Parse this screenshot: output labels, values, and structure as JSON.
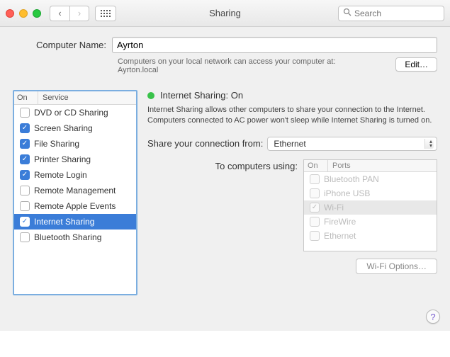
{
  "window": {
    "title": "Sharing"
  },
  "search": {
    "placeholder": "Search"
  },
  "computer_name": {
    "label": "Computer Name:",
    "value": "Ayrton",
    "sub1": "Computers on your local network can access your computer at:",
    "sub2": "Ayrton.local",
    "edit_label": "Edit…"
  },
  "services": {
    "head_on": "On",
    "head_service": "Service",
    "items": [
      {
        "label": "DVD or CD Sharing",
        "on": false,
        "selected": false
      },
      {
        "label": "Screen Sharing",
        "on": true,
        "selected": false
      },
      {
        "label": "File Sharing",
        "on": true,
        "selected": false
      },
      {
        "label": "Printer Sharing",
        "on": true,
        "selected": false
      },
      {
        "label": "Remote Login",
        "on": true,
        "selected": false
      },
      {
        "label": "Remote Management",
        "on": false,
        "selected": false
      },
      {
        "label": "Remote Apple Events",
        "on": false,
        "selected": false
      },
      {
        "label": "Internet Sharing",
        "on": true,
        "selected": true
      },
      {
        "label": "Bluetooth Sharing",
        "on": false,
        "selected": false
      }
    ]
  },
  "detail": {
    "status_title": "Internet Sharing: On",
    "status_color": "#39c24a",
    "desc": "Internet Sharing allows other computers to share your connection to the Internet. Computers connected to AC power won't sleep while Internet Sharing is turned on.",
    "share_from_label": "Share your connection from:",
    "share_from_value": "Ethernet",
    "to_label": "To computers using:",
    "ports": {
      "head_on": "On",
      "head_ports": "Ports",
      "items": [
        {
          "label": "Bluetooth PAN",
          "on": false,
          "selected": false
        },
        {
          "label": "iPhone USB",
          "on": false,
          "selected": false
        },
        {
          "label": "Wi-Fi",
          "on": true,
          "selected": true
        },
        {
          "label": "FireWire",
          "on": false,
          "selected": false
        },
        {
          "label": "Ethernet",
          "on": false,
          "selected": false
        }
      ]
    },
    "wifi_options_label": "Wi-Fi Options…"
  },
  "help": {
    "label": "?"
  }
}
